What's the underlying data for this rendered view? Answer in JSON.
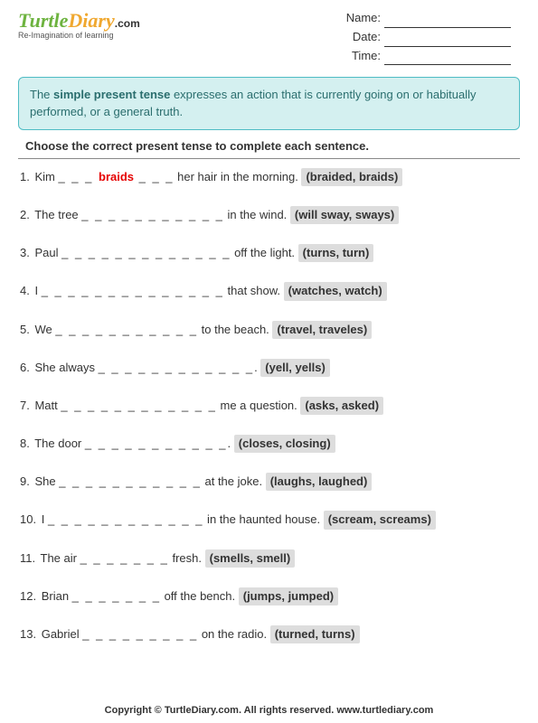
{
  "logo": {
    "word1": "Turtle",
    "word2": "Diary",
    "suffix": ".com",
    "tagline": "Re-Imagination of learning"
  },
  "info": {
    "name": "Name:",
    "date": "Date:",
    "time": "Time:"
  },
  "descbox": {
    "prefix": "The ",
    "bold": "simple present tense",
    "rest": " expresses an action that is currently going on or habitually performed, or a general truth."
  },
  "instruction": "Choose the correct present tense to complete each sentence.",
  "questions": [
    {
      "n": "1.",
      "pre": "Kim ",
      "blank": "_ _ _ ",
      "ans": "braids",
      "blank2": " _ _ _",
      "post": " her hair in the morning.  ",
      "opts": "(braided, braids)"
    },
    {
      "n": "2.",
      "pre": "The tree ",
      "blank": "_ _ _ _ _ _ _ _ _ _ _",
      "post": " in the wind.  ",
      "opts": "(will sway, sways)"
    },
    {
      "n": "3.",
      "pre": "Paul ",
      "blank": "_ _ _ _ _ _ _ _ _ _ _ _ _",
      "post": " off the light.  ",
      "opts": "(turns, turn)"
    },
    {
      "n": "4.",
      "pre": "I ",
      "blank": "_ _ _ _ _ _ _ _ _ _ _ _ _ _",
      "post": " that show.  ",
      "opts": "(watches, watch)"
    },
    {
      "n": "5.",
      "pre": "We ",
      "blank": "_ _ _ _ _ _ _ _ _ _ _",
      "post": " to the beach.  ",
      "opts": "(travel, traveles)"
    },
    {
      "n": "6.",
      "pre": "She always ",
      "blank": "_ _ _ _ _ _ _ _ _ _ _ _",
      "post": ".  ",
      "opts": "(yell, yells)"
    },
    {
      "n": "7.",
      "pre": "Matt ",
      "blank": "_ _ _ _ _ _ _ _ _ _ _ _",
      "post": " me a question.  ",
      "opts": "(asks, asked)"
    },
    {
      "n": "8.",
      "pre": "The door ",
      "blank": "_ _ _ _ _ _ _ _ _ _ _",
      "post": ".  ",
      "opts": "(closes, closing)"
    },
    {
      "n": "9.",
      "pre": "She ",
      "blank": "_ _ _ _ _ _ _ _ _ _ _",
      "post": " at the joke.  ",
      "opts": "(laughs, laughed)"
    },
    {
      "n": "10.",
      "pre": "I ",
      "blank": "_ _ _ _ _ _ _ _ _ _ _ _",
      "post": " in the haunted house.  ",
      "opts": "(scream, screams)"
    },
    {
      "n": "11.",
      "pre": "The air ",
      "blank": "_ _ _ _ _ _ _",
      "post": " fresh.  ",
      "opts": "(smells, smell)"
    },
    {
      "n": "12.",
      "pre": "Brian ",
      "blank": "_ _ _ _ _ _ _",
      "post": " off the bench.  ",
      "opts": "(jumps, jumped)"
    },
    {
      "n": "13.",
      "pre": "Gabriel ",
      "blank": "_ _ _ _ _ _ _ _ _",
      "post": " on the radio.  ",
      "opts": "(turned, turns)"
    }
  ],
  "footer": "Copyright © TurtleDiary.com. All rights reserved. www.turtlediary.com"
}
